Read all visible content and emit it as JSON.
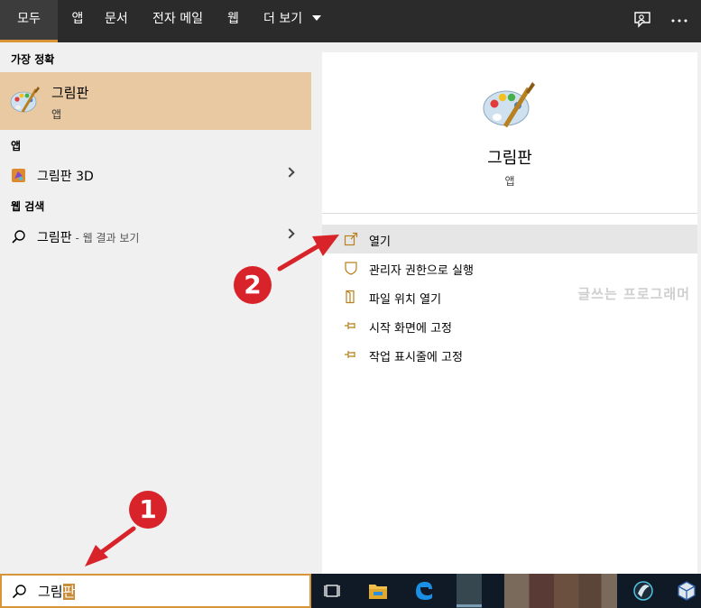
{
  "nav": {
    "tabs": [
      {
        "label": "모두"
      },
      {
        "label": "앱"
      },
      {
        "label": "문서"
      },
      {
        "label": "전자 메일"
      },
      {
        "label": "웹"
      },
      {
        "label": "더 보기"
      }
    ]
  },
  "left": {
    "best_match_header": "가장 정확",
    "best_match": {
      "title": "그림판",
      "subtitle": "앱"
    },
    "apps_header": "앱",
    "app_item": "그림판 3D",
    "web_header": "웹 검색",
    "web_item_term": "그림판",
    "web_item_suffix": " - 웹 결과 보기"
  },
  "right": {
    "app_name": "그림판",
    "app_type": "앱",
    "actions": [
      {
        "label": "열기",
        "icon": "open-icon"
      },
      {
        "label": "관리자 권한으로 실행",
        "icon": "shield-icon"
      },
      {
        "label": "파일 위치 열기",
        "icon": "file-location-icon"
      },
      {
        "label": "시작 화면에 고정",
        "icon": "pin-icon"
      },
      {
        "label": "작업 표시줄에 고정",
        "icon": "pin-icon"
      }
    ],
    "watermark": "글쓰는 프로그래머"
  },
  "search": {
    "typed": "그림",
    "composing": "판"
  },
  "annotations": {
    "step1": "1",
    "step2": "2"
  },
  "colors": {
    "accent": "#d79537",
    "selection": "#e8c9a1",
    "badge": "#d9232a",
    "topbar": "#2b2b2b"
  }
}
